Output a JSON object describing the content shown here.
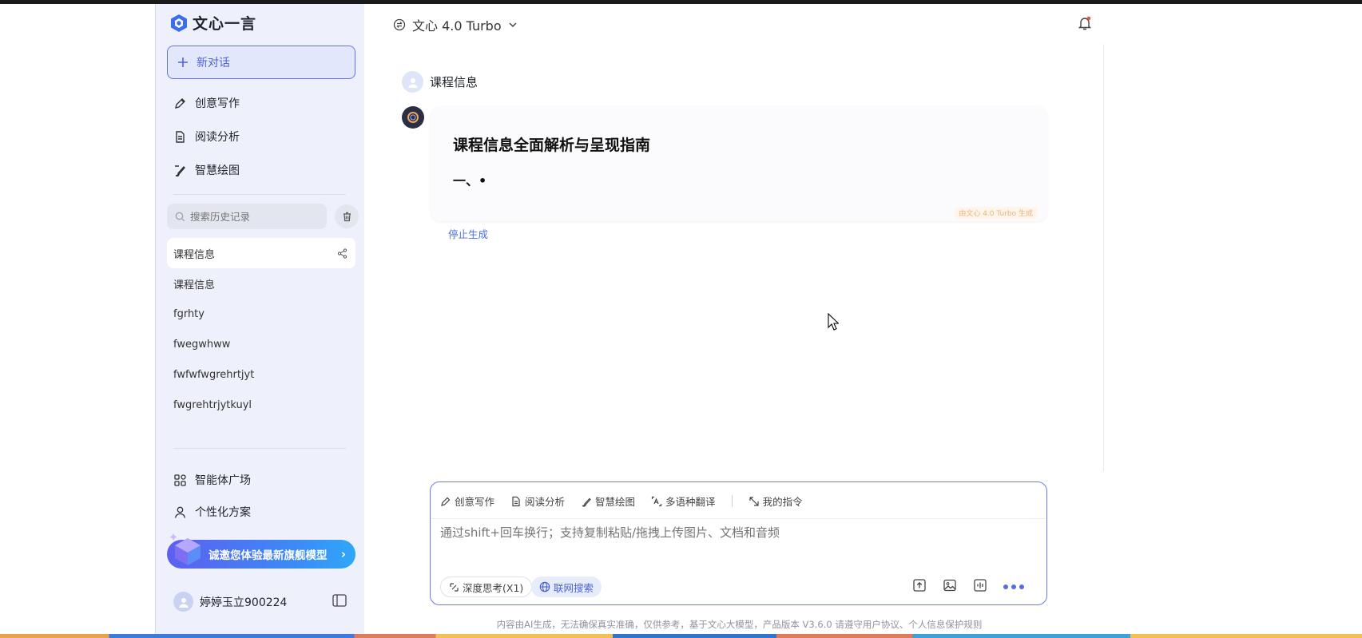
{
  "app": {
    "name": "文心一言"
  },
  "sidebar": {
    "new_chat": "新对话",
    "nav": [
      {
        "label": "创意写作",
        "icon": "pen-icon"
      },
      {
        "label": "阅读分析",
        "icon": "document-icon"
      },
      {
        "label": "智慧绘图",
        "icon": "brush-icon"
      }
    ],
    "search_placeholder": "搜索历史记录",
    "history": [
      "课程信息",
      "课程信息",
      "fgrhty",
      "fwegwhww",
      "fwfwfwgrehrtjyt",
      "fwgrehtrjytkuyl"
    ],
    "bottom_nav": [
      {
        "label": "智能体广场",
        "icon": "grid-icon"
      },
      {
        "label": "个性化方案",
        "icon": "person-icon"
      }
    ],
    "promo": "诚邀您体验最新旗舰模型",
    "user_name": "婷婷玉立900224"
  },
  "header": {
    "model": "文心 4.0 Turbo"
  },
  "chat": {
    "user_message": "课程信息",
    "answer_title": "课程信息全面解析与呈现指南",
    "answer_line": "一、•",
    "generated_by": "由文心 4.0 Turbo 生成",
    "stop_label": "停止生成"
  },
  "composer": {
    "tools": [
      {
        "label": "创意写作",
        "icon": "pen-icon"
      },
      {
        "label": "阅读分析",
        "icon": "document-icon"
      },
      {
        "label": "智慧绘图",
        "icon": "brush-icon"
      },
      {
        "label": "多语种翻译",
        "icon": "translate-icon"
      },
      {
        "label": "我的指令",
        "icon": "command-icon"
      }
    ],
    "placeholder": "通过shift+回车换行；支持复制粘贴/拖拽上传图片、文档和音频",
    "deep_think": "深度思考(X1)",
    "web_search": "联网搜索"
  },
  "footer": "内容由AI生成，无法确保真实准确，仅供参考，基于文心大模型，产品版本 V3.6.0 请遵守用户协议、个人信息保护规则",
  "colors": {
    "accent": "#4e63d8",
    "sidebar_bg": "#eef1fb",
    "composer_border": "#6a7be8"
  }
}
